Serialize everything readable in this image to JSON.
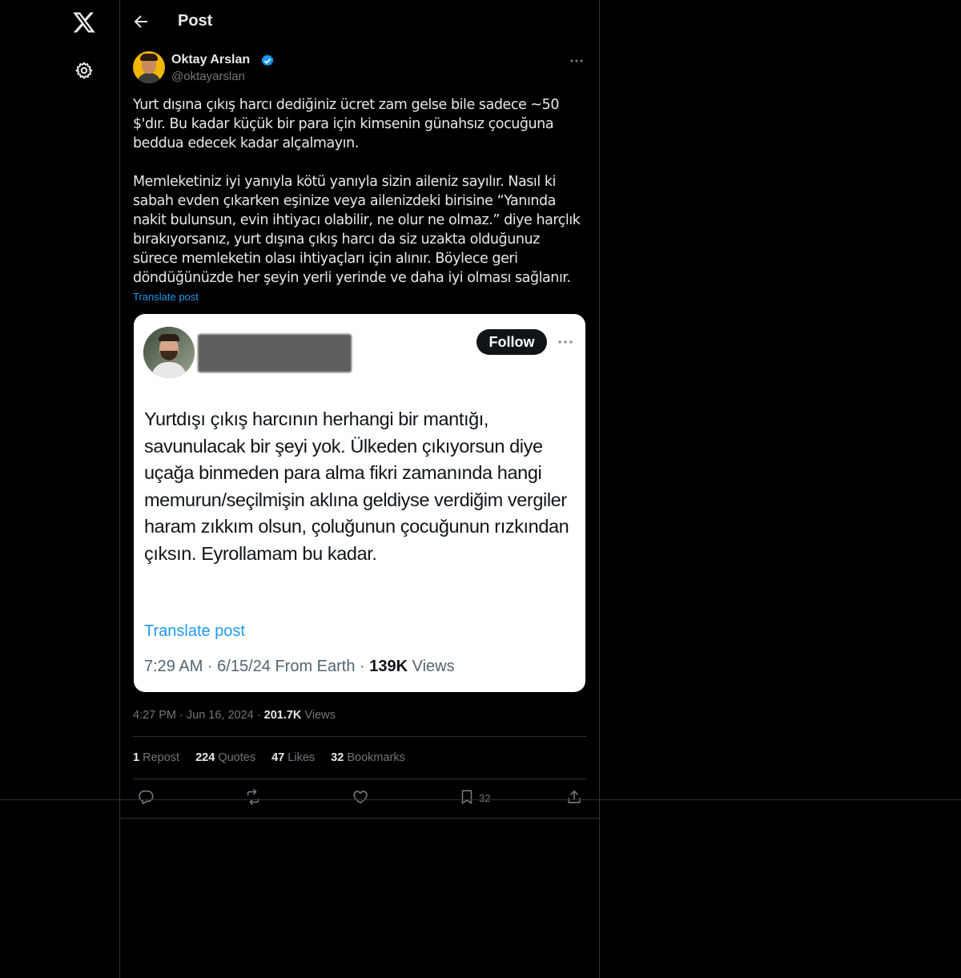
{
  "nav": {
    "logo_icon": "x-logo-icon",
    "settings_icon": "gear-icon"
  },
  "header": {
    "title": "Post"
  },
  "author": {
    "name": "Oktay Arslan",
    "handle": "@oktayarslan",
    "verified": true
  },
  "post": {
    "text": "Yurt dışına çıkış harcı dediğiniz ücret zam gelse bile sadece ~50 $'dır. Bu kadar küçük bir para için kimsenin günahsız çocuğuna beddua edecek kadar alçalmayın.\n\nMemleketiniz iyi yanıyla kötü yanıyla sizin aileniz sayılır. Nasıl ki sabah evden çıkarken eşinize veya ailenizdeki birisine “Yanında nakit bulunsun, evin ihtiyacı olabilir, ne olur ne olmaz.” diye harçlık bırakıyorsanız, yurt dışına çıkış harcı da siz uzakta olduğunuz sürece memleketin olası ihtiyaçları için alınır. Böylece geri döndüğünüzde her şeyin yerli yerinde ve daha iyi olması sağlanır.",
    "translate_label": "Translate post"
  },
  "quoted_image": {
    "follow_label": "Follow",
    "text": "Yurtdışı çıkış harcının herhangi bir mantığı, savunulacak bir şeyi yok. Ülkeden çıkıyorsun diye uçağa binmeden para alma fikri zamanında hangi memurun/seçilmişin aklına geldiyse verdiğim vergiler haram zıkkım olsun, çoluğunun çocuğunun rızkından çıksın. Eyrollamam bu kadar.",
    "translate_label": "Translate post",
    "meta_prefix": "7:29 AM · 6/15/24 From Earth · ",
    "views_count": "139K",
    "views_label": " Views"
  },
  "meta": {
    "time": "4:27 PM",
    "dot": " · ",
    "date": "Jun 16, 2024",
    "views_count": "201.7K",
    "views_label": " Views"
  },
  "stats": {
    "reposts_count": "1",
    "reposts_label": " Repost",
    "quotes_count": "224",
    "quotes_label": " Quotes",
    "likes_count": "47",
    "likes_label": " Likes",
    "bookmarks_count": "32",
    "bookmarks_label": " Bookmarks"
  },
  "actions": {
    "bookmark_count": "32",
    "icons": [
      "reply-icon",
      "repost-icon",
      "like-icon",
      "bookmark-icon",
      "share-icon"
    ]
  },
  "colors": {
    "accent": "#1d9bf0",
    "background": "#000000",
    "text": "#e7e9ea",
    "muted": "#71767b",
    "border": "#2f3336"
  }
}
